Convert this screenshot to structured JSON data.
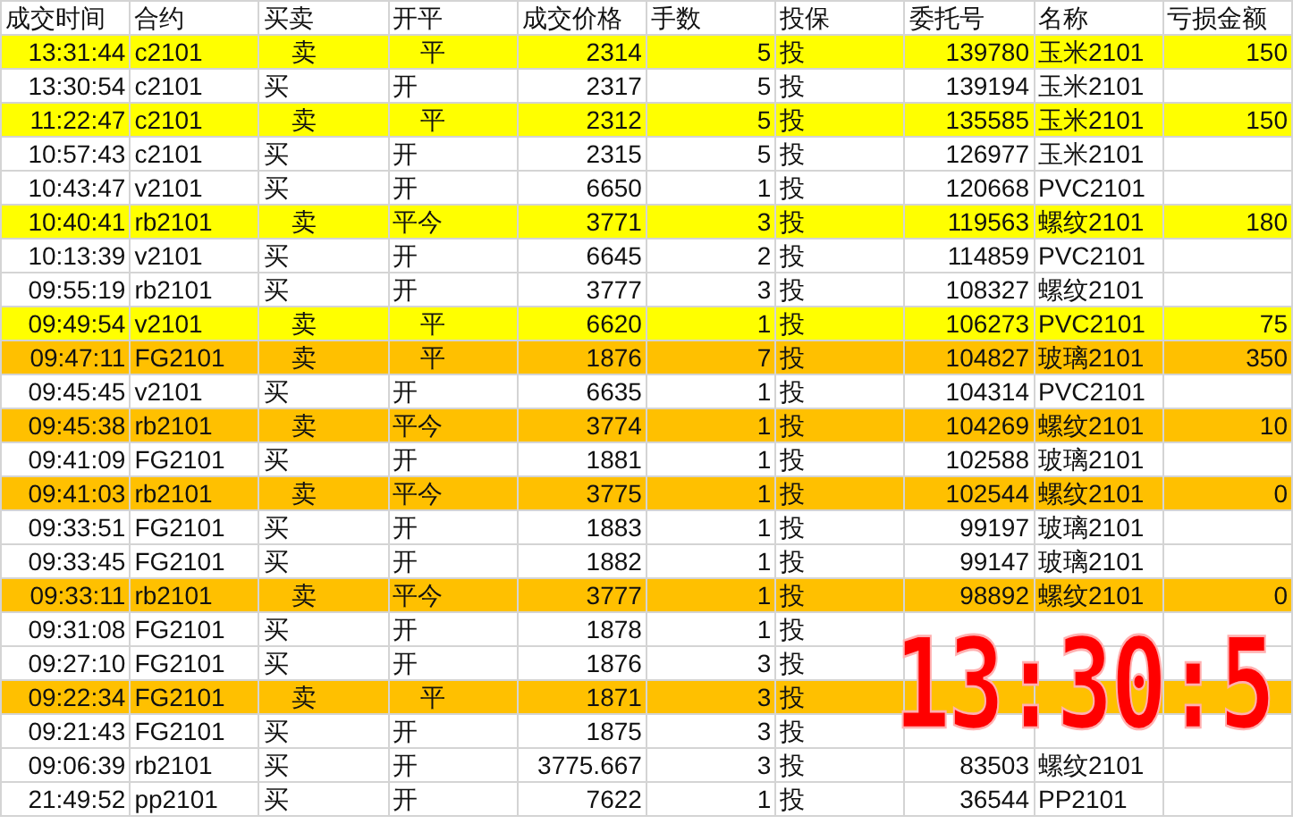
{
  "table": {
    "columns": [
      "成交时间",
      "合约",
      "买卖",
      "开平",
      "成交价格",
      "手数",
      "投保",
      "委托号",
      "名称",
      "亏损金额"
    ],
    "rows": [
      {
        "cells": [
          "13:31:44",
          "c2101",
          "    卖",
          "    平",
          "2314",
          "5",
          "投",
          "139780",
          "玉米2101",
          "150"
        ],
        "color": "#ffff00"
      },
      {
        "cells": [
          "13:30:54",
          "c2101",
          "买",
          "开",
          "2317",
          "5",
          "投",
          "139194",
          "玉米2101",
          ""
        ]
      },
      {
        "cells": [
          "11:22:47",
          "c2101",
          "    卖",
          "    平",
          "2312",
          "5",
          "投",
          "135585",
          "玉米2101",
          "150"
        ],
        "color": "#ffff00"
      },
      {
        "cells": [
          "10:57:43",
          "c2101",
          "买",
          "开",
          "2315",
          "5",
          "投",
          "126977",
          "玉米2101",
          ""
        ]
      },
      {
        "cells": [
          "10:43:47",
          "v2101",
          "买",
          "开",
          "6650",
          "1",
          "投",
          "120668",
          "PVC2101",
          ""
        ]
      },
      {
        "cells": [
          "10:40:41",
          "rb2101",
          "    卖",
          "平今",
          "3771",
          "3",
          "投",
          "119563",
          "螺纹2101",
          "180"
        ],
        "color": "#ffff00"
      },
      {
        "cells": [
          "10:13:39",
          "v2101",
          "买",
          "开",
          "6645",
          "2",
          "投",
          "114859",
          "PVC2101",
          ""
        ]
      },
      {
        "cells": [
          "09:55:19",
          "rb2101",
          "买",
          "开",
          "3777",
          "3",
          "投",
          "108327",
          "螺纹2101",
          ""
        ]
      },
      {
        "cells": [
          "09:49:54",
          "v2101",
          "    卖",
          "    平",
          "6620",
          "1",
          "投",
          "106273",
          "PVC2101",
          "75"
        ],
        "color": "#ffff00"
      },
      {
        "cells": [
          "09:47:11",
          "FG2101",
          "    卖",
          "    平",
          "1876",
          "7",
          "投",
          "104827",
          "玻璃2101",
          "350"
        ],
        "color": "#ffc000"
      },
      {
        "cells": [
          "09:45:45",
          "v2101",
          "买",
          "开",
          "6635",
          "1",
          "投",
          "104314",
          "PVC2101",
          ""
        ]
      },
      {
        "cells": [
          "09:45:38",
          "rb2101",
          "    卖",
          "平今",
          "3774",
          "1",
          "投",
          "104269",
          "螺纹2101",
          "10"
        ],
        "color": "#ffc000"
      },
      {
        "cells": [
          "09:41:09",
          "FG2101",
          "买",
          "开",
          "1881",
          "1",
          "投",
          "102588",
          "玻璃2101",
          ""
        ]
      },
      {
        "cells": [
          "09:41:03",
          "rb2101",
          "    卖",
          "平今",
          "3775",
          "1",
          "投",
          "102544",
          "螺纹2101",
          "0"
        ],
        "color": "#ffc000"
      },
      {
        "cells": [
          "09:33:51",
          "FG2101",
          "买",
          "开",
          "1883",
          "1",
          "投",
          "99197",
          "玻璃2101",
          ""
        ]
      },
      {
        "cells": [
          "09:33:45",
          "FG2101",
          "买",
          "开",
          "1882",
          "1",
          "投",
          "99147",
          "玻璃2101",
          ""
        ]
      },
      {
        "cells": [
          "09:33:11",
          "rb2101",
          "    卖",
          "平今",
          "3777",
          "1",
          "投",
          "98892",
          "螺纹2101",
          "0"
        ],
        "color": "#ffc000"
      },
      {
        "cells": [
          "09:31:08",
          "FG2101",
          "买",
          "开",
          "1878",
          "1",
          "投",
          "",
          "",
          ""
        ]
      },
      {
        "cells": [
          "09:27:10",
          "FG2101",
          "买",
          "开",
          "1876",
          "3",
          "投",
          "",
          "",
          ""
        ]
      },
      {
        "cells": [
          "09:22:34",
          "FG2101",
          "    卖",
          "    平",
          "1871",
          "3",
          "投",
          "",
          "",
          ""
        ],
        "color": "#ffc000"
      },
      {
        "cells": [
          "09:21:43",
          "FG2101",
          "买",
          "开",
          "1875",
          "3",
          "投",
          "",
          "",
          ""
        ]
      },
      {
        "cells": [
          "09:06:39",
          "rb2101",
          "买",
          "开",
          "3775.667",
          "3",
          "投",
          "83503",
          "螺纹2101",
          ""
        ]
      },
      {
        "cells": [
          "21:49:52",
          "pp2101",
          "买",
          "开",
          "7622",
          "1",
          "投",
          "36544",
          "PP2101",
          ""
        ]
      }
    ]
  },
  "clock": {
    "time": "13:30:5"
  }
}
